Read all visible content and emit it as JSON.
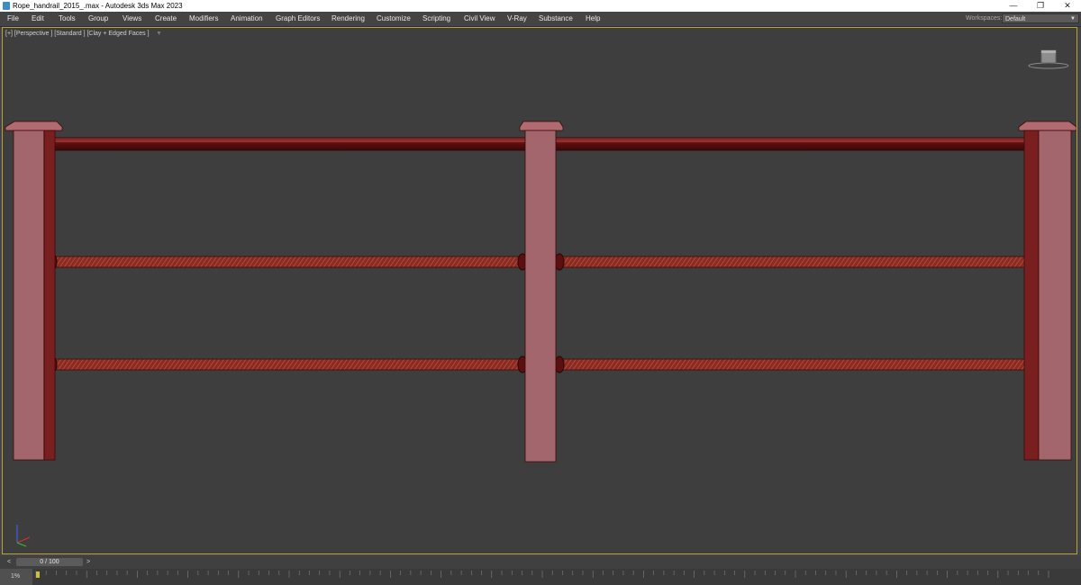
{
  "window": {
    "title": "Rope_handrail_2015_.max - Autodesk 3ds Max 2023",
    "buttons": [
      "—",
      "❐",
      "✕"
    ]
  },
  "menu": {
    "items": [
      "File",
      "Edit",
      "Tools",
      "Group",
      "Views",
      "Create",
      "Modifiers",
      "Animation",
      "Graph Editors",
      "Rendering",
      "Customize",
      "Scripting",
      "Civil View",
      "V-Ray",
      "Substance",
      "Help"
    ],
    "workspaces_label": "Workspaces:",
    "workspace_value": "Default"
  },
  "viewport": {
    "label": "[+] [Perspective ] [Standard ] [Clay + Edged Faces ]",
    "filter_icon": "filter-icon"
  },
  "timeline": {
    "prev": "<",
    "next": ">",
    "counter": "0 / 100",
    "percent": "1%"
  },
  "colors": {
    "viewport_bg": "#3e3e3e",
    "viewport_border": "#b7a23c",
    "post_face": "#a2666c",
    "post_side": "#7a1f1f",
    "rope": "#8a2a20",
    "rail": "#6e1212"
  }
}
